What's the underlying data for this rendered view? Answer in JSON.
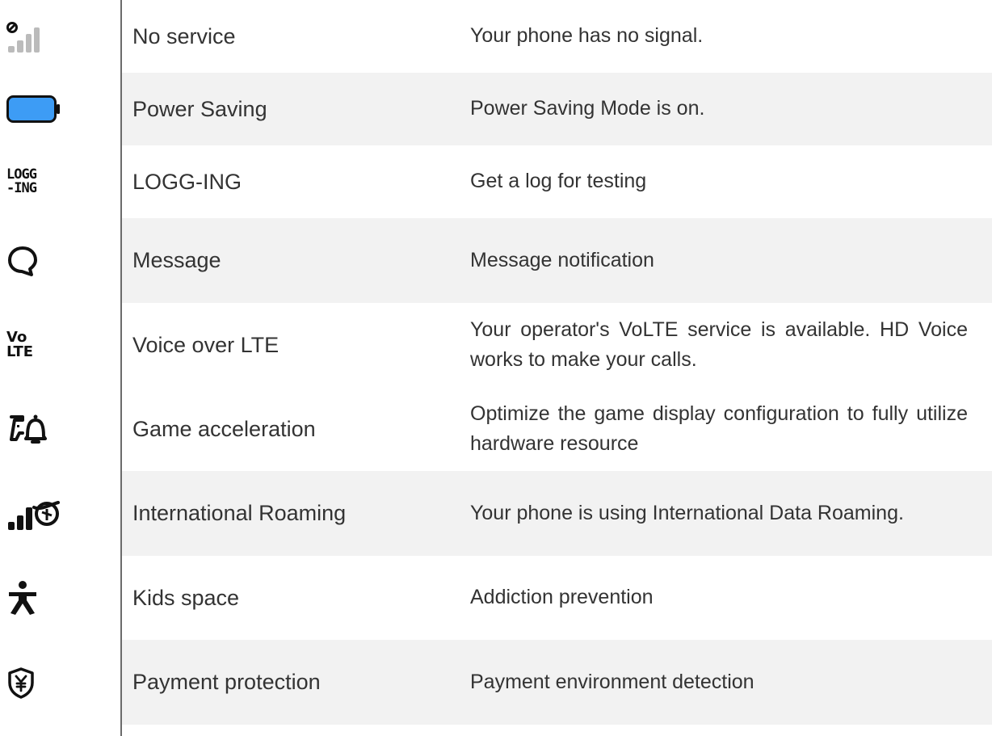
{
  "rows": [
    {
      "icon": "no-signal-icon",
      "name": "No service",
      "desc": "Your phone has no signal."
    },
    {
      "icon": "battery-power-saving-icon",
      "name": "Power Saving",
      "desc": "Power Saving Mode is on."
    },
    {
      "icon": "logging-icon",
      "name": "LOGG-ING",
      "desc": "Get a log for testing"
    },
    {
      "icon": "message-icon",
      "name": "Message",
      "desc": "Message notification"
    },
    {
      "icon": "volte-icon",
      "name": "Voice over LTE",
      "desc": "Your operator's VoLTE service is available. HD Voice works to make your calls."
    },
    {
      "icon": "game-acceleration-icon",
      "name": "Game acceleration",
      "desc": "Optimize the game display configuration to fully utilize hardware resource"
    },
    {
      "icon": "international-roaming-icon",
      "name": "International Roaming",
      "desc": "Your phone is using International Data Roaming."
    },
    {
      "icon": "kids-space-icon",
      "name": "Kids space",
      "desc": "Addiction prevention"
    },
    {
      "icon": "payment-protection-icon",
      "name": "Payment protection",
      "desc": "Payment environment detection"
    }
  ],
  "icon_text": {
    "logging_top": "LOGG",
    "logging_bottom": "-ING",
    "volte_top": "Vo",
    "volte_bottom": "LTE"
  },
  "colors": {
    "battery_fill": "#3d9cf5",
    "row_shade": "#f2f2f2"
  }
}
